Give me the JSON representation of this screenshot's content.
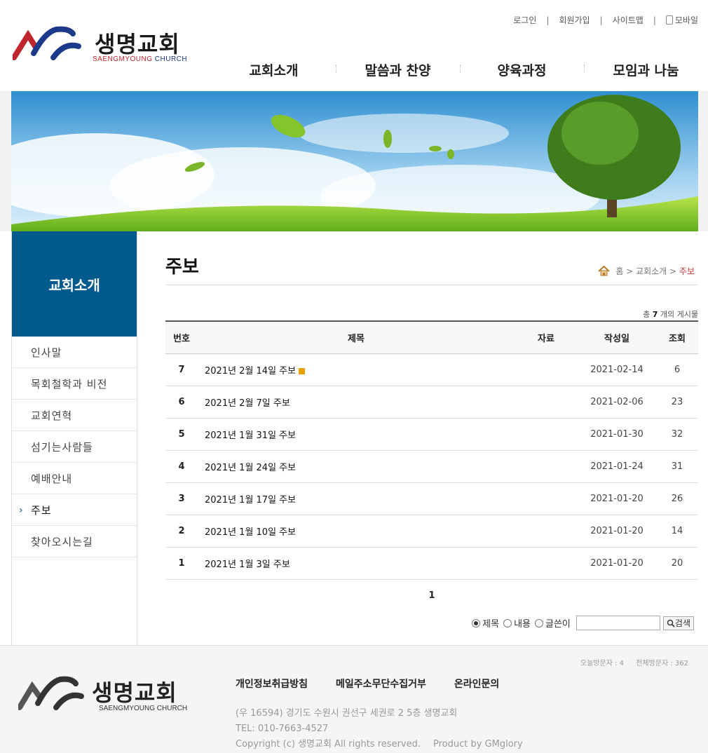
{
  "header": {
    "logo_kr": "생명교회",
    "logo_en_a": "SAENGMYOUNG",
    "logo_en_b": "CHURCH",
    "util": {
      "login": "로그인",
      "join": "회원가입",
      "sitemap": "사이트맵",
      "mobile": "모바일"
    },
    "nav": [
      "교회소개",
      "말씀과 찬양",
      "양육과정",
      "모임과 나눔"
    ]
  },
  "sidebar": {
    "title": "교회소개",
    "items": [
      "인사말",
      "목회철학과 비전",
      "교회연혁",
      "섬기는사람들",
      "예배안내",
      "주보",
      "찾아오시는길"
    ],
    "active_index": 5
  },
  "content": {
    "page_title": "주보",
    "breadcrumb": {
      "home": "홈",
      "section": "교회소개",
      "current": "주보"
    },
    "total": {
      "prefix": "총",
      "count": "7",
      "suffix": "개의 게시물"
    },
    "columns": {
      "no": "번호",
      "title": "제목",
      "file": "자료",
      "date": "작성일",
      "hits": "조회"
    },
    "rows": [
      {
        "no": "7",
        "title": "2021년 2월 14일 주보",
        "date": "2021-02-14",
        "hits": "6",
        "new": true
      },
      {
        "no": "6",
        "title": "2021년 2월 7일 주보",
        "date": "2021-02-06",
        "hits": "23"
      },
      {
        "no": "5",
        "title": "2021년 1월 31일 주보",
        "date": "2021-01-30",
        "hits": "32"
      },
      {
        "no": "4",
        "title": "2021년 1월 24일 주보",
        "date": "2021-01-24",
        "hits": "31"
      },
      {
        "no": "3",
        "title": "2021년 1월 17일 주보",
        "date": "2021-01-20",
        "hits": "26"
      },
      {
        "no": "2",
        "title": "2021년 1월 10일 주보",
        "date": "2021-01-20",
        "hits": "14"
      },
      {
        "no": "1",
        "title": "2021년 1월 3일 주보",
        "date": "2021-01-20",
        "hits": "20"
      }
    ],
    "pager": {
      "current": "1"
    },
    "search": {
      "options": [
        "제목",
        "내용",
        "글쓴이"
      ],
      "selected": "제목",
      "button": "검색",
      "value": ""
    }
  },
  "footer": {
    "visitors": {
      "today": "오늘방문자 : 4",
      "total": "전체방문자 : 362"
    },
    "logo_kr": "생명교회",
    "logo_en": "SAENGMYOUNG CHURCH",
    "links": [
      "개인정보취급방침",
      "메일주소무단수집거부",
      "온라인문의"
    ],
    "address": "(우 16594) 경기도 수원시 권선구 세권로 2 5층 생명교회",
    "tel": "TEL: 010-7663-4527",
    "copyright": "Copyright (c) 생명교회 All rights reserved.",
    "product": "Product by GMglory"
  },
  "colors": {
    "accent": "#005a8e",
    "breadcrumb_current": "#d03030",
    "logo_red": "#c0262e",
    "logo_blue": "#1d3a8a"
  }
}
